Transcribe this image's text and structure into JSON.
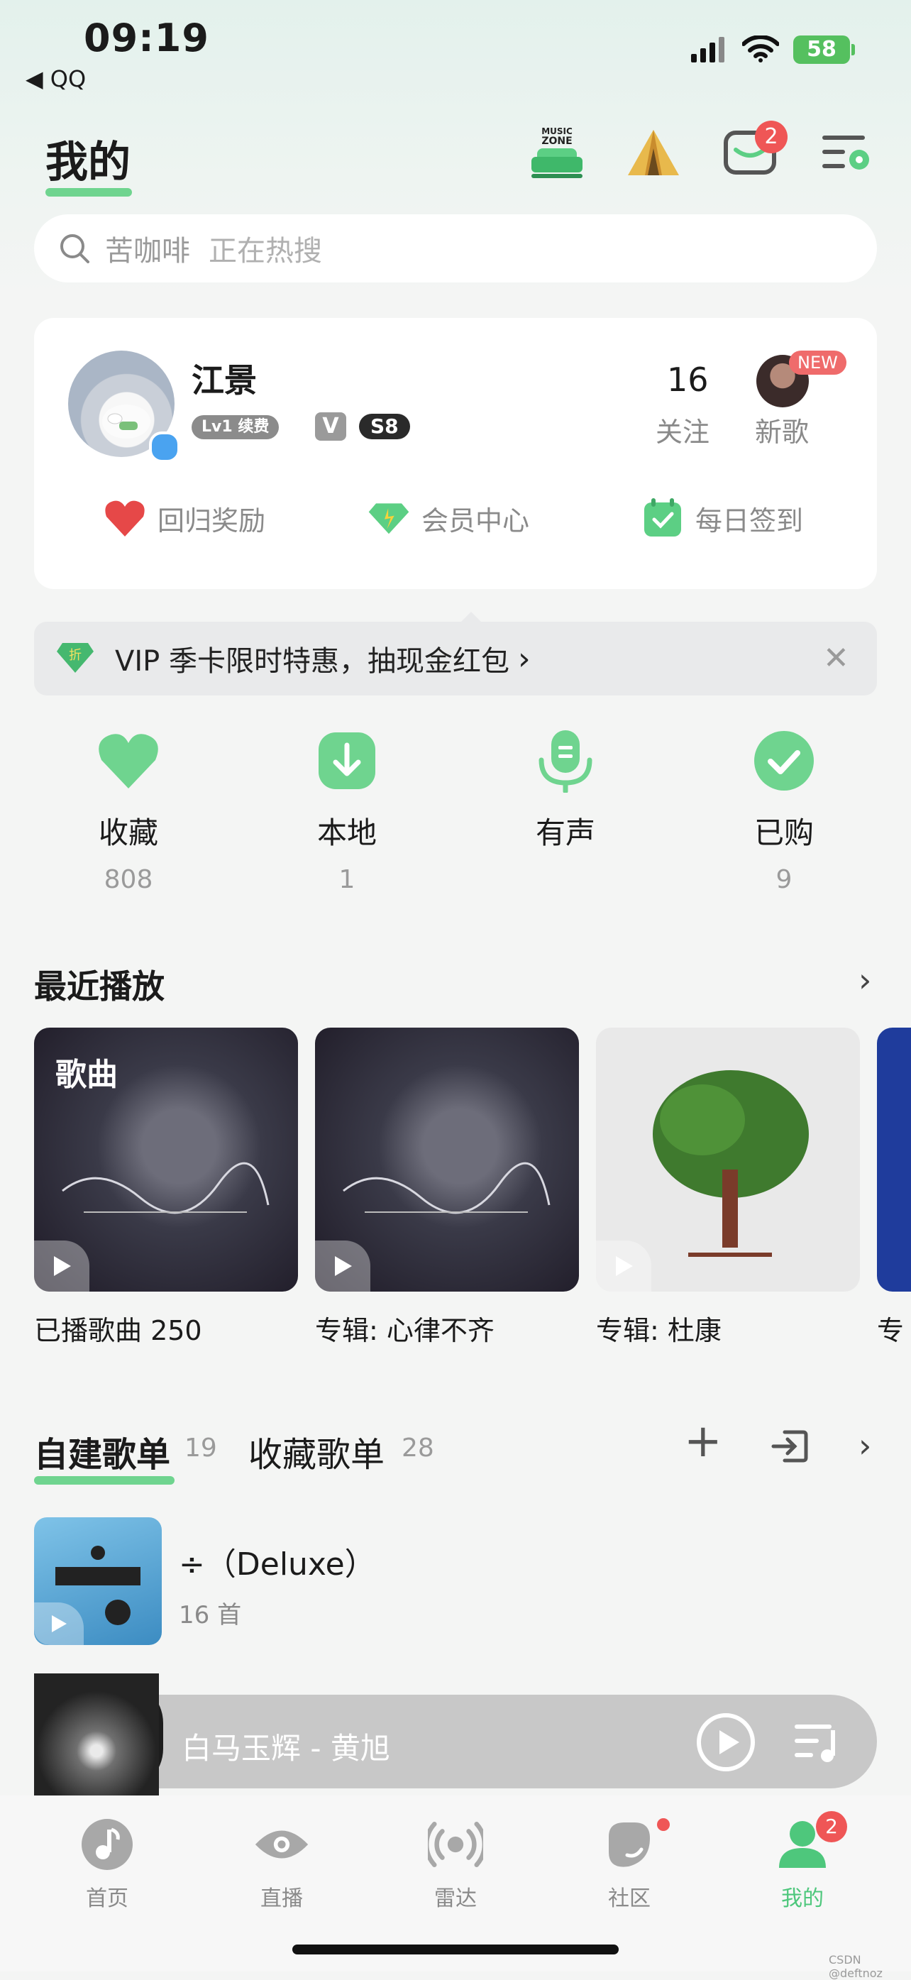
{
  "status_bar": {
    "time": "09:19",
    "back_label": "◀ QQ",
    "battery": "58"
  },
  "header": {
    "title": "我的",
    "message_badge": "2",
    "icons": [
      "music-zone-icon",
      "tent-icon",
      "message-icon",
      "menu-settings-icon"
    ]
  },
  "search": {
    "placeholder": "苦咖啡",
    "hot_label": "正在热搜"
  },
  "profile": {
    "name": "江景",
    "level_badge": "Lv1 续费",
    "vip_badge": "V",
    "rank_badge": "S8",
    "following_count": "16",
    "following_label": "关注",
    "new_tag": "NEW",
    "new_songs_label": "新歌",
    "quick_actions": [
      {
        "label": "回归奖励",
        "icon": "heart-pixel-icon"
      },
      {
        "label": "会员中心",
        "icon": "diamond-icon"
      },
      {
        "label": "每日签到",
        "icon": "calendar-check-icon"
      }
    ]
  },
  "vip_banner": {
    "badge": "折",
    "text": "VIP 季卡限时特惠，抽现金红包",
    "arrow": "›",
    "close": "✕"
  },
  "categories": [
    {
      "label": "收藏",
      "count": "808",
      "icon": "heart-icon"
    },
    {
      "label": "本地",
      "count": "1",
      "icon": "download-icon"
    },
    {
      "label": "有声",
      "count": "",
      "icon": "microphone-icon"
    },
    {
      "label": "已购",
      "count": "9",
      "icon": "check-icon"
    }
  ],
  "recent": {
    "title": "最近播放",
    "chevron": "›",
    "tag": "歌曲",
    "items": [
      {
        "label": "已播歌曲 250"
      },
      {
        "label": "专辑: 心律不齐"
      },
      {
        "label": "专辑: 杜康"
      },
      {
        "label": "专"
      }
    ]
  },
  "playlists": {
    "tab_created": "自建歌单",
    "tab_created_count": "19",
    "tab_collected": "收藏歌单",
    "tab_collected_count": "28",
    "add": "+",
    "chevron": "›",
    "items": [
      {
        "title": "÷（Deluxe）",
        "subtitle": "16 首"
      }
    ]
  },
  "player": {
    "title": "白马玉辉 - 黄旭"
  },
  "tabbar": {
    "items": [
      {
        "label": "首页",
        "icon": "home-note-icon"
      },
      {
        "label": "直播",
        "icon": "eye-icon"
      },
      {
        "label": "雷达",
        "icon": "radar-icon"
      },
      {
        "label": "社区",
        "icon": "community-icon"
      },
      {
        "label": "我的",
        "icon": "profile-icon"
      }
    ],
    "badge": "2"
  },
  "watermark": "CSDN @deftnoz",
  "colors": {
    "accent": "#4ec77c",
    "accent_light": "#6fd48f",
    "badge": "#ef5656",
    "background": "#f4f5f4"
  }
}
